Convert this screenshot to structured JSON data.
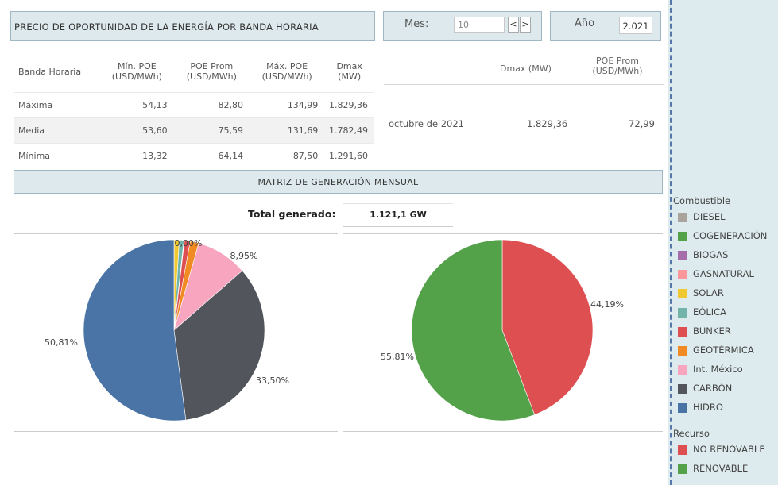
{
  "header": {
    "title": "PRECIO DE OPORTUNIDAD DE LA ENERGÍA POR BANDA HORARIA",
    "mes_label": "Mes:",
    "mes_value": "10",
    "prev_symbol": "<",
    "next_symbol": ">",
    "anio_label": "Año",
    "anio_value": "2.021"
  },
  "poe_table": {
    "headers": [
      "Banda Horaria",
      "Mín. POE (USD/MWh)",
      "POE Prom (USD/MWh)",
      "Máx. POE (USD/MWh)",
      "Dmax (MW)"
    ],
    "rows": [
      [
        "Máxima",
        "54,13",
        "82,80",
        "134,99",
        "1.829,36"
      ],
      [
        "Media",
        "53,60",
        "75,59",
        "131,69",
        "1.782,49"
      ],
      [
        "Mínima",
        "13,32",
        "64,14",
        "87,50",
        "1.291,60"
      ]
    ]
  },
  "monthly_summary": {
    "headers": [
      "Dmax (MW)",
      "POE Prom (USD/MWh)"
    ],
    "period": "octubre de 2021",
    "dmax": "1.829,36",
    "poe_prom": "72,99"
  },
  "matrix": {
    "title": "MATRIZ DE GENERACIÓN MENSUAL",
    "total_label": "Total generado:",
    "total_value": "1.121,1 GW"
  },
  "legend": {
    "fuel_title": "Combustible",
    "fuels": [
      {
        "label": "DIESEL",
        "color": "#aaa49c"
      },
      {
        "label": "COGENERACIÓN",
        "color": "#53a24a"
      },
      {
        "label": "BIOGAS",
        "color": "#a66dab"
      },
      {
        "label": "GASNATURAL",
        "color": "#f9979b"
      },
      {
        "label": "SOLAR",
        "color": "#f0c832"
      },
      {
        "label": "EÓLICA",
        "color": "#72b4a9"
      },
      {
        "label": "BUNKER",
        "color": "#de4f51"
      },
      {
        "label": "GEOTÉRMICA",
        "color": "#f08b24"
      },
      {
        "label": "Int. México",
        "color": "#f8a5c0"
      },
      {
        "label": "CARBÓN",
        "color": "#52565c"
      },
      {
        "label": "HIDRO",
        "color": "#4a74a6"
      }
    ],
    "resource_title": "Recurso",
    "resources": [
      {
        "label": "NO RENOVABLE",
        "color": "#de4f51"
      },
      {
        "label": "RENOVABLE",
        "color": "#53a24a"
      }
    ]
  },
  "chart_data": [
    {
      "type": "pie",
      "slices": [
        {
          "name": "SOLAR",
          "value": 0.9,
          "color": "#f0c832"
        },
        {
          "name": "EÓLICA",
          "value": 0.8,
          "color": "#72b4a9"
        },
        {
          "name": "BIOGAS",
          "value": 0.1,
          "color": "#a66dab"
        },
        {
          "name": "BUNKER",
          "value": 1.0,
          "color": "#de4f51"
        },
        {
          "name": "GEOTÉRMICA",
          "value": 1.5,
          "color": "#f08b24"
        },
        {
          "name": "DIESEL",
          "value": 0.0,
          "color": "#aaa49c"
        },
        {
          "name": "Int. México",
          "value": 8.95,
          "color": "#f8a5c0"
        },
        {
          "name": "CARBÓN",
          "value": 33.5,
          "color": "#52565c"
        },
        {
          "name": "HIDRO",
          "value": 50.81,
          "color": "#4a74a6"
        }
      ],
      "labels": [
        {
          "text": "0,00%",
          "slice": "DIESEL"
        },
        {
          "text": "8,95%",
          "slice": "Int. México"
        },
        {
          "text": "33,50%",
          "slice": "CARBÓN"
        },
        {
          "text": "50,81%",
          "slice": "HIDRO"
        }
      ]
    },
    {
      "type": "pie",
      "slices": [
        {
          "name": "NO RENOVABLE",
          "value": 44.19,
          "color": "#de4f51"
        },
        {
          "name": "RENOVABLE",
          "value": 55.81,
          "color": "#53a24a"
        }
      ],
      "labels": [
        {
          "text": "44,19%",
          "slice": "NO RENOVABLE"
        },
        {
          "text": "55,81%",
          "slice": "RENOVABLE"
        }
      ]
    }
  ]
}
